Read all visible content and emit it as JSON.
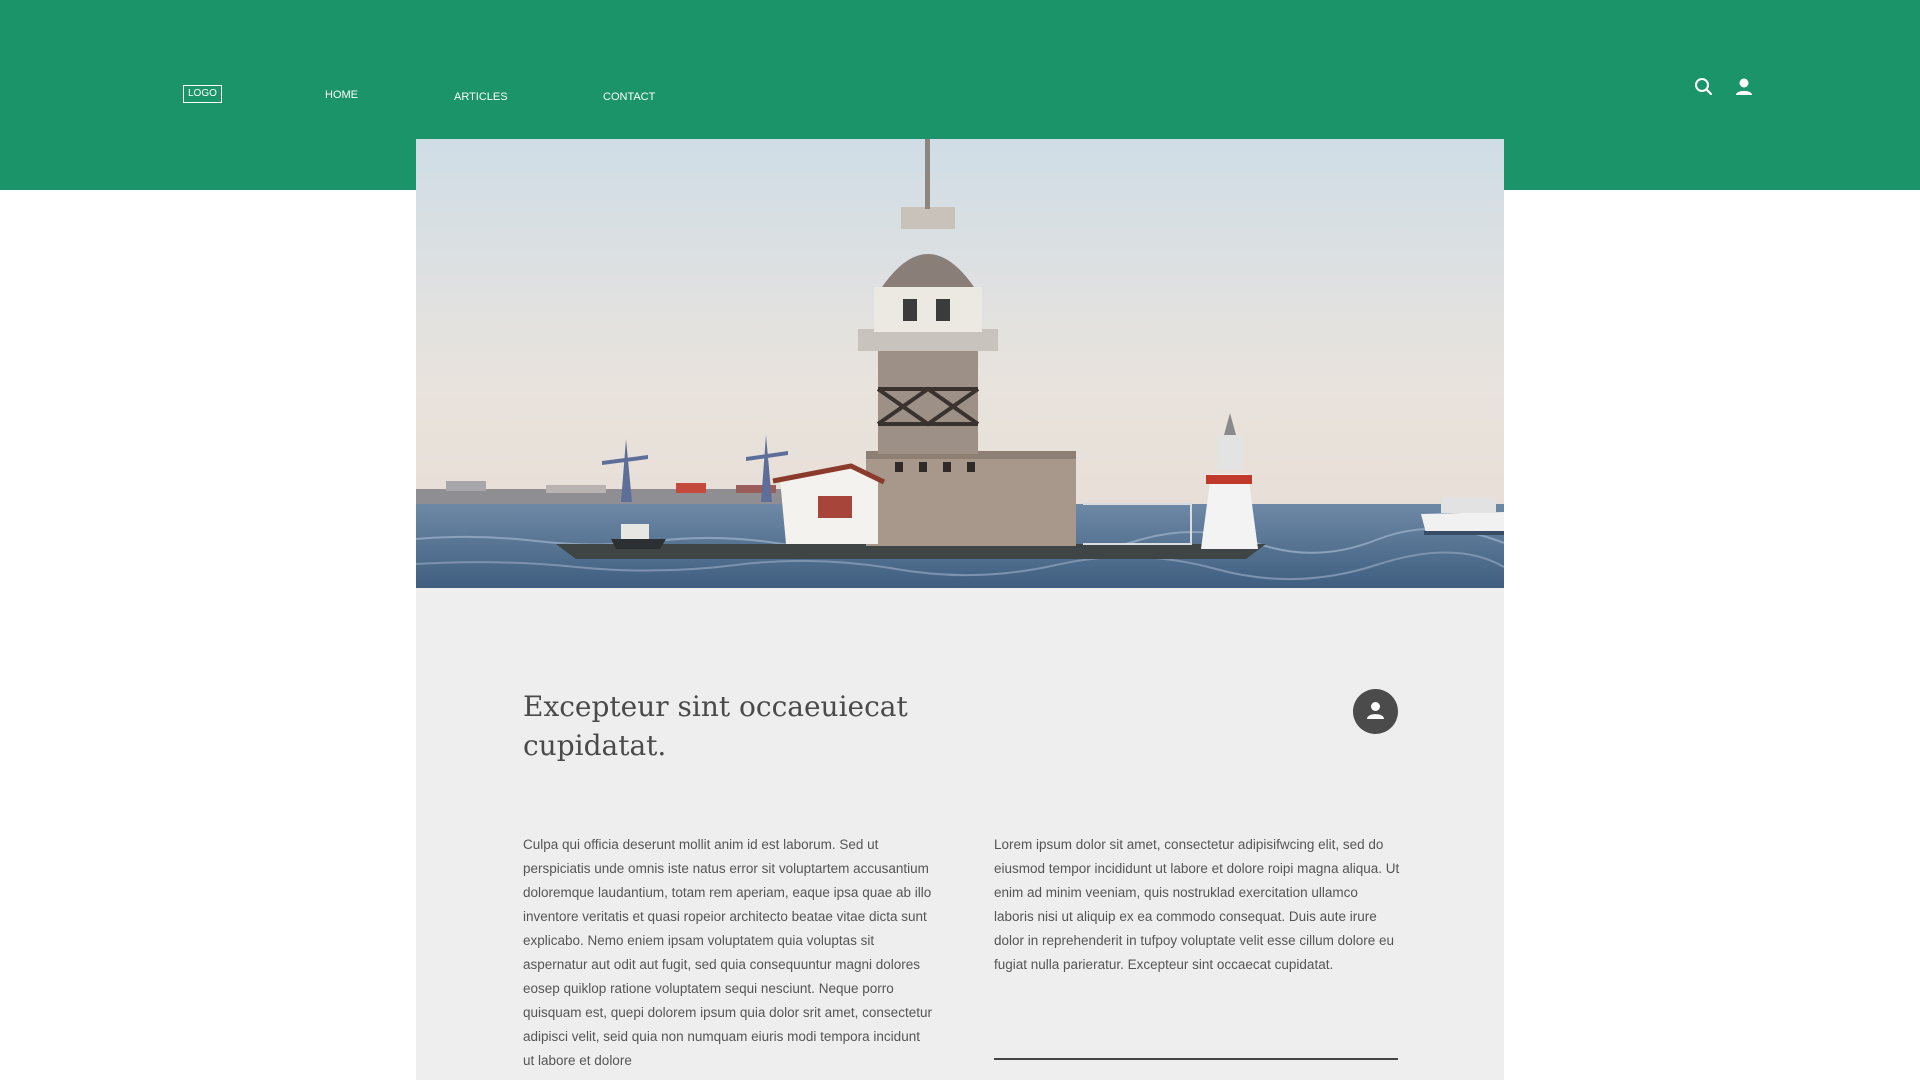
{
  "header": {
    "logo": "LOGO",
    "nav": [
      {
        "label": "HOME"
      },
      {
        "label": "ARTICLES"
      },
      {
        "label": "CONTACT"
      }
    ],
    "icons": [
      "search-icon",
      "user-icon"
    ],
    "background_color": "#1b9469"
  },
  "article": {
    "hero_image": "maidens-tower-lighthouse-photo",
    "title": "Excepteur sint occaeuiecat cupidatat.",
    "author_icon": "user-avatar-icon",
    "left_text": "Culpa qui officia deserunt mollit anim id est laborum. Sed ut perspiciatis unde omnis iste natus error sit voluptartem accusantium doloremque laudantium, totam rem aperiam, eaque ipsa quae ab illo inventore veritatis et quasi ropeior architecto beatae vitae dicta sunt explicabo. Nemo eniem ipsam voluptatem quia voluptas sit aspernatur aut odit aut fugit, sed quia consequuntur magni dolores eosep quiklop ratione voluptatem sequi nesciunt. Neque porro quisquam est, quepi dolorem ipsum quia dolor srit amet, consectetur adipisci velit, seid quia non numquam eiuris modi tempora incidunt ut labore et dolore",
    "right_text": "Lorem ipsum dolor sit amet, consectetur adipisifwcing elit, sed do eiusmod tempor incididunt ut labore et dolore roipi magna aliqua. Ut enim ad minim veeniam, quis nostruklad exercitation ullamco laboris nisi ut aliquip ex ea commodo consequat. Duis aute irure dolor in reprehenderit in tufpoy voluptate velit esse cillum dolore eu fugiat nulla parieratur. Excepteur sint occaecat cupidatat.",
    "panel_color": "#eeeeee"
  }
}
